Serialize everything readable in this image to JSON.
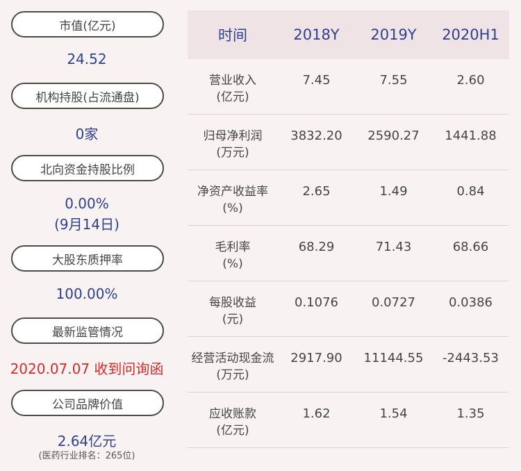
{
  "left": {
    "items": [
      {
        "label": "市值(亿元)",
        "value": "24.52"
      },
      {
        "label": "机构持股(占流通盘)",
        "value": "0家"
      },
      {
        "label": "北向资金持股比例",
        "value": "0.00%",
        "value2": "(9月14日)"
      },
      {
        "label": "大股东质押率",
        "value": "100.00%"
      },
      {
        "label": "最新监管情况",
        "value": "2020.07.07 收到问询函"
      },
      {
        "label": "公司品牌价值",
        "value": "2.64亿元",
        "note": "(医药行业排名：265位)"
      }
    ]
  },
  "table": {
    "headers": [
      "时间",
      "2018Y",
      "2019Y",
      "2020H1"
    ],
    "rows": [
      {
        "name1": "营业收入",
        "name2": "(亿元)",
        "values": [
          "7.45",
          "7.55",
          "2.60"
        ]
      },
      {
        "name1": "归母净利润",
        "name2": "(万元)",
        "values": [
          "3832.20",
          "2590.27",
          "1441.88"
        ]
      },
      {
        "name1": "净资产收益率",
        "name2": "(%)",
        "values": [
          "2.65",
          "1.49",
          "0.84"
        ]
      },
      {
        "name1": "毛利率",
        "name2": "(%)",
        "values": [
          "68.29",
          "71.43",
          "68.66"
        ]
      },
      {
        "name1": "每股收益",
        "name2": "(元)",
        "values": [
          "0.1076",
          "0.0727",
          "0.0386"
        ]
      },
      {
        "name1": "经营活动现金流",
        "name2": "(万元)",
        "values": [
          "2917.90",
          "11144.55",
          "-2443.53"
        ]
      },
      {
        "name1": "应收账款",
        "name2": "(亿元)",
        "values": [
          "1.62",
          "1.54",
          "1.35"
        ]
      }
    ]
  },
  "colors": {
    "value": "#2d3f8f",
    "alert": "#d72b2b",
    "header_bg": "#efe3e6",
    "page_bg": "#f9f2f3"
  }
}
